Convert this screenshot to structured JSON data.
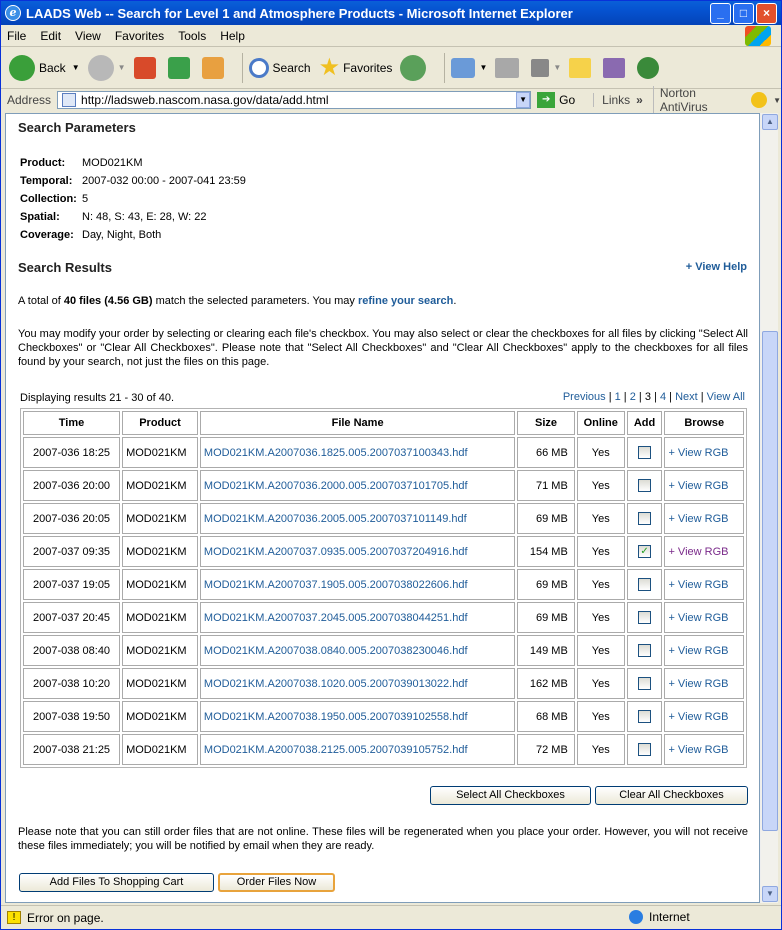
{
  "window": {
    "title": "LAADS Web -- Search for Level 1 and Atmosphere Products - Microsoft Internet Explorer"
  },
  "menu": [
    "File",
    "Edit",
    "View",
    "Favorites",
    "Tools",
    "Help"
  ],
  "toolbar": {
    "back": "Back",
    "search": "Search",
    "favorites": "Favorites"
  },
  "address": {
    "label": "Address",
    "url": "http://ladsweb.nascom.nasa.gov/data/add.html",
    "go": "Go",
    "links": "Links",
    "norton": "Norton AntiVirus"
  },
  "params": {
    "title": "Search Parameters",
    "items": [
      {
        "label": "Product:",
        "value": "MOD021KM"
      },
      {
        "label": "Temporal:",
        "value": "2007-032 00:00 - 2007-041 23:59"
      },
      {
        "label": "Collection:",
        "value": "5"
      },
      {
        "label": "Spatial:",
        "value": "N: 48, S: 43, E: 28, W: 22"
      },
      {
        "label": "Coverage:",
        "value": "Day, Night, Both"
      }
    ]
  },
  "results": {
    "title": "Search Results",
    "help": "+ View Help",
    "summary_pre": "A total of ",
    "summary_files": "40 files (4.56 GB)",
    "summary_mid": " match the selected parameters. You may ",
    "refine": "refine your search",
    "summary_end": ".",
    "modify_note": "You may modify your order by selecting or clearing each file's checkbox. You may also select or clear the checkboxes for all files by clicking \"Select All Checkboxes\" or \"Clear All Checkboxes\". Please note that \"Select All Checkboxes\" and \"Clear All Checkboxes\" apply to the checkboxes for all files found by your search, not just the files on this page.",
    "displaying": "Displaying results 21 - 30 of 40.",
    "pager": {
      "prev": "Previous",
      "pages": [
        "1",
        "2",
        "3",
        "4"
      ],
      "current": "3",
      "next": "Next",
      "all": "View All"
    },
    "columns": [
      "Time",
      "Product",
      "File Name",
      "Size",
      "Online",
      "Add",
      "Browse"
    ],
    "rows": [
      {
        "time": "2007-036 18:25",
        "product": "MOD021KM",
        "file": "MOD021KM.A2007036.1825.005.2007037100343.hdf",
        "size": "66 MB",
        "online": "Yes",
        "checked": false,
        "browse": "+ View RGB"
      },
      {
        "time": "2007-036 20:00",
        "product": "MOD021KM",
        "file": "MOD021KM.A2007036.2000.005.2007037101705.hdf",
        "size": "71 MB",
        "online": "Yes",
        "checked": false,
        "browse": "+ View RGB"
      },
      {
        "time": "2007-036 20:05",
        "product": "MOD021KM",
        "file": "MOD021KM.A2007036.2005.005.2007037101149.hdf",
        "size": "69 MB",
        "online": "Yes",
        "checked": false,
        "browse": "+ View RGB"
      },
      {
        "time": "2007-037 09:35",
        "product": "MOD021KM",
        "file": "MOD021KM.A2007037.0935.005.2007037204916.hdf",
        "size": "154 MB",
        "online": "Yes",
        "checked": true,
        "browse": "+ View RGB"
      },
      {
        "time": "2007-037 19:05",
        "product": "MOD021KM",
        "file": "MOD021KM.A2007037.1905.005.2007038022606.hdf",
        "size": "69 MB",
        "online": "Yes",
        "checked": false,
        "browse": "+ View RGB"
      },
      {
        "time": "2007-037 20:45",
        "product": "MOD021KM",
        "file": "MOD021KM.A2007037.2045.005.2007038044251.hdf",
        "size": "69 MB",
        "online": "Yes",
        "checked": false,
        "browse": "+ View RGB"
      },
      {
        "time": "2007-038 08:40",
        "product": "MOD021KM",
        "file": "MOD021KM.A2007038.0840.005.2007038230046.hdf",
        "size": "149 MB",
        "online": "Yes",
        "checked": false,
        "browse": "+ View RGB"
      },
      {
        "time": "2007-038 10:20",
        "product": "MOD021KM",
        "file": "MOD021KM.A2007038.1020.005.2007039013022.hdf",
        "size": "162 MB",
        "online": "Yes",
        "checked": false,
        "browse": "+ View RGB"
      },
      {
        "time": "2007-038 19:50",
        "product": "MOD021KM",
        "file": "MOD021KM.A2007038.1950.005.2007039102558.hdf",
        "size": "68 MB",
        "online": "Yes",
        "checked": false,
        "browse": "+ View RGB"
      },
      {
        "time": "2007-038 21:25",
        "product": "MOD021KM",
        "file": "MOD021KM.A2007038.2125.005.2007039105752.hdf",
        "size": "72 MB",
        "online": "Yes",
        "checked": false,
        "browse": "+ View RGB"
      }
    ]
  },
  "actions": {
    "select_all": "Select All Checkboxes",
    "clear_all": "Clear All Checkboxes",
    "add_cart": "Add Files To Shopping Cart",
    "order_now": "Order Files Now"
  },
  "offline_note": "Please note that you can still order files that are not online. These files will be regenerated when you place your order. However, you will not receive these files immediately; you will be notified by email when they are ready.",
  "status": {
    "text": "Error on page.",
    "zone": "Internet"
  }
}
